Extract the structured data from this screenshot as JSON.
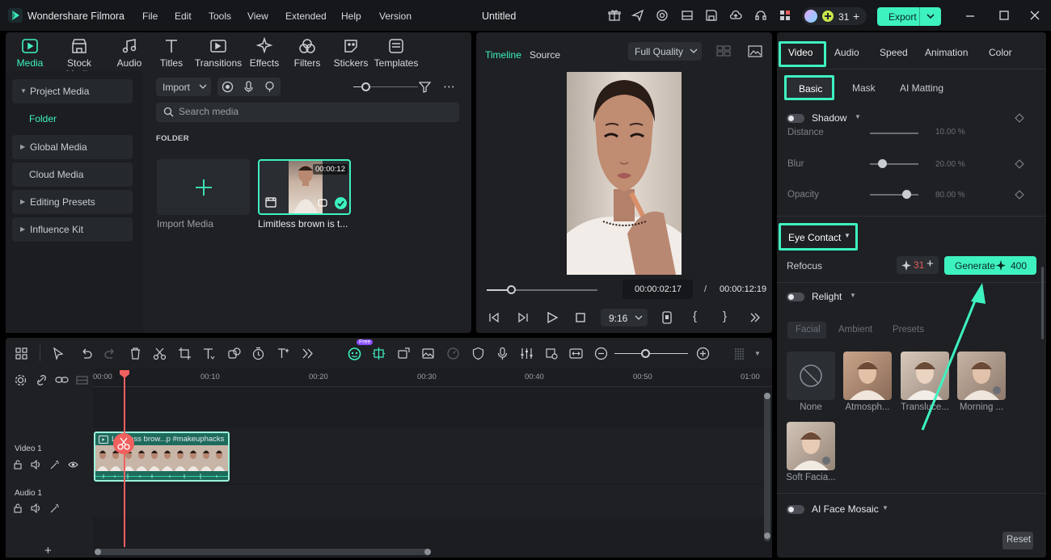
{
  "app": {
    "name": "Wondershare Filmora",
    "document_title": "Untitled",
    "menu": [
      "File",
      "Edit",
      "Tools",
      "View",
      "Extended",
      "Help",
      "Version"
    ],
    "credits": "31",
    "export_label": "Export",
    "accent": "#3ef2c0"
  },
  "media": {
    "tabs": [
      "Media",
      "Stock Media",
      "Audio",
      "Titles",
      "Transitions",
      "Effects",
      "Filters",
      "Stickers",
      "Templates"
    ],
    "sidebar": {
      "project_media": "Project Media",
      "folder": "Folder",
      "global_media": "Global Media",
      "cloud_media": "Cloud Media",
      "editing_presets": "Editing Presets",
      "influence_kit": "Influence Kit"
    },
    "import_label": "Import",
    "search_placeholder": "Search media",
    "section_label": "FOLDER",
    "import_tile_label": "Import Media",
    "clip_label": "Limitless brown is t...",
    "clip_duration": "00:00:12"
  },
  "preview": {
    "tab_timeline": "Timeline",
    "tab_source": "Source",
    "quality": "Full Quality",
    "current_time": "00:00:02:17",
    "separator": "/",
    "total_time": "00:00:12:19",
    "aspect": "9:16",
    "progress": 0.22
  },
  "props": {
    "tabs": [
      "Video",
      "Audio",
      "Speed",
      "Animation",
      "Color"
    ],
    "subtabs": [
      "Basic",
      "Mask",
      "AI Matting"
    ],
    "shadow_label": "Shadow",
    "distance_label": "Distance",
    "distance_value": "10.00 %",
    "blur_label": "Blur",
    "blur_value": "20.00 %",
    "opacity_label": "Opacity",
    "opacity_value": "80.00 %",
    "eye_contact_label": "Eye Contact",
    "refocus_label": "Refocus",
    "refocus_credits": "31",
    "generate_label": "Generate",
    "generate_cost": "400",
    "relight_label": "Relight",
    "relight_tabs": [
      "Facial",
      "Ambient",
      "Presets"
    ],
    "relight_presets": [
      "None",
      "Atmosph...",
      "Transluce...",
      "Morning ...",
      "Soft Facia..."
    ],
    "ai_face_mosaic_label": "AI Face Mosaic",
    "reset_label": "Reset"
  },
  "timeline": {
    "ruler": [
      "00:00",
      "00:10",
      "00:20",
      "00:30",
      "00:40",
      "00:50",
      "01:00"
    ],
    "free_badge": "Free",
    "video_track": "Video 1",
    "audio_track": "Audio 1",
    "clip_title": "Limitless brow...p #makeuphacks"
  }
}
